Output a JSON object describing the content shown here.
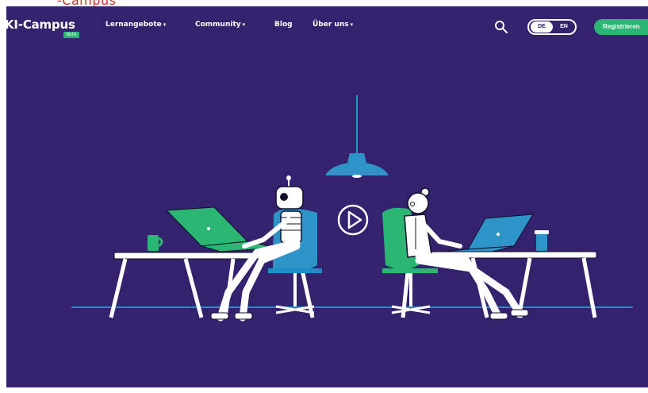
{
  "top_fragment": "-Campus",
  "header": {
    "logo_text": "KI-Campus",
    "logo_badge": "BETA",
    "nav": [
      {
        "label": "Lernangebote",
        "dropdown": true
      },
      {
        "label": "Community",
        "dropdown": true
      },
      {
        "label": "Blog",
        "dropdown": false
      },
      {
        "label": "Über uns",
        "dropdown": true
      }
    ],
    "search_icon": "search-icon",
    "language": {
      "options": [
        "DE",
        "EN"
      ],
      "selected": "DE"
    },
    "register_label": "Registrieren"
  },
  "hero": {
    "play_icon": "play-icon",
    "illustration": "robot-and-person-at-desks"
  },
  "colors": {
    "background": "#35226f",
    "accent_green": "#2bb673",
    "accent_blue": "#1f8fc8",
    "lamp_blue": "#2e94c8",
    "white": "#ffffff"
  }
}
